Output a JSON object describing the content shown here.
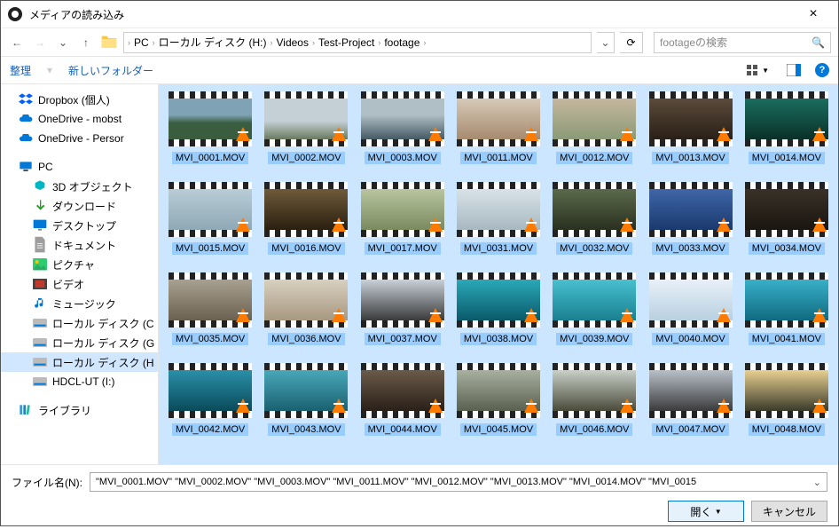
{
  "window": {
    "title": "メディアの読み込み",
    "close": "×"
  },
  "breadcrumb": {
    "items": [
      "PC",
      "ローカル ディスク (H:)",
      "Videos",
      "Test-Project",
      "footage"
    ]
  },
  "search": {
    "placeholder": "footageの検索"
  },
  "toolbar": {
    "organize": "整理",
    "newfolder": "新しいフォルダー"
  },
  "sidebar": {
    "items": [
      {
        "label": "Dropbox (個人)",
        "icon": "dropbox",
        "level": 0
      },
      {
        "label": "OneDrive - mobst",
        "icon": "cloud",
        "level": 0
      },
      {
        "label": "OneDrive - Persor",
        "icon": "cloud",
        "level": 0
      },
      {
        "spacer": true
      },
      {
        "label": "PC",
        "icon": "pc",
        "level": 0
      },
      {
        "label": "3D オブジェクト",
        "icon": "3d",
        "level": 1
      },
      {
        "label": "ダウンロード",
        "icon": "download",
        "level": 1
      },
      {
        "label": "デスクトップ",
        "icon": "desktop",
        "level": 1
      },
      {
        "label": "ドキュメント",
        "icon": "doc",
        "level": 1
      },
      {
        "label": "ピクチャ",
        "icon": "pic",
        "level": 1
      },
      {
        "label": "ビデオ",
        "icon": "video",
        "level": 1
      },
      {
        "label": "ミュージック",
        "icon": "music",
        "level": 1
      },
      {
        "label": "ローカル ディスク (C",
        "icon": "disk",
        "level": 1
      },
      {
        "label": "ローカル ディスク (G",
        "icon": "disk",
        "level": 1
      },
      {
        "label": "ローカル ディスク (H",
        "icon": "disk",
        "level": 1,
        "selected": true
      },
      {
        "label": "HDCL-UT (I:)",
        "icon": "disk",
        "level": 1
      },
      {
        "spacer": true
      },
      {
        "label": "ライブラリ",
        "icon": "lib",
        "level": 0
      }
    ]
  },
  "files": [
    {
      "name": "MVI_0001.MOV",
      "bg": "linear-gradient(#7fa3b5 40%,#3a5c3f 60%)"
    },
    {
      "name": "MVI_0002.MOV",
      "bg": "linear-gradient(#c5d0d6 55%,#6a7a5e)"
    },
    {
      "name": "MVI_0003.MOV",
      "bg": "linear-gradient(#b0bec5 40%,#455a64)"
    },
    {
      "name": "MVI_0011.MOV",
      "bg": "linear-gradient(#d7c9b8,#a68b6e)"
    },
    {
      "name": "MVI_0012.MOV",
      "bg": "linear-gradient(#c5b79e,#8a9a76)"
    },
    {
      "name": "MVI_0013.MOV",
      "bg": "linear-gradient(#5a4a3a,#2a2018)"
    },
    {
      "name": "MVI_0014.MOV",
      "bg": "linear-gradient(#1a6e5f,#0a3028)"
    },
    {
      "name": "MVI_0015.MOV",
      "bg": "linear-gradient(#b8cdd6,#8fa8b5)"
    },
    {
      "name": "MVI_0016.MOV",
      "bg": "linear-gradient(#6e5a3a,#2a1f10)"
    },
    {
      "name": "MVI_0017.MOV",
      "bg": "linear-gradient(#b8c5a0,#7a8a5e)"
    },
    {
      "name": "MVI_0031.MOV",
      "bg": "linear-gradient(#d8e2e8,#a8b8c0)"
    },
    {
      "name": "MVI_0032.MOV",
      "bg": "linear-gradient(#5a6a4a,#2a3020)"
    },
    {
      "name": "MVI_0033.MOV",
      "bg": "linear-gradient(#4066a8,#1a3a6e)"
    },
    {
      "name": "MVI_0034.MOV",
      "bg": "linear-gradient(#3a3228,#1a1510)"
    },
    {
      "name": "MVI_0035.MOV",
      "bg": "linear-gradient(#a8a090,#6a6050)"
    },
    {
      "name": "MVI_0036.MOV",
      "bg": "linear-gradient(#d8d0c0,#a89880)"
    },
    {
      "name": "MVI_0037.MOV",
      "bg": "linear-gradient(#c8d0d8,#3a3a3a)"
    },
    {
      "name": "MVI_0038.MOV",
      "bg": "linear-gradient(#2aa8b8,#0a5a6a)"
    },
    {
      "name": "MVI_0039.MOV",
      "bg": "linear-gradient(#48c0d0,#1a8090)"
    },
    {
      "name": "MVI_0040.MOV",
      "bg": "linear-gradient(#e8f0f8,#b8d0e0)"
    },
    {
      "name": "MVI_0041.MOV",
      "bg": "linear-gradient(#38b0c8,#106a80)"
    },
    {
      "name": "MVI_0042.MOV",
      "bg": "linear-gradient(#2a90a8,#0a4a5a)"
    },
    {
      "name": "MVI_0043.MOV",
      "bg": "linear-gradient(#48a8b8,#1a6070)"
    },
    {
      "name": "MVI_0044.MOV",
      "bg": "linear-gradient(#6a5a4a,#2a2018)"
    },
    {
      "name": "MVI_0045.MOV",
      "bg": "linear-gradient(#a8b0a0,#5a6050)"
    },
    {
      "name": "MVI_0046.MOV",
      "bg": "linear-gradient(#c8d0c8,#4a4a3a)"
    },
    {
      "name": "MVI_0047.MOV",
      "bg": "linear-gradient(#b8c0c8,#3a3a3a)"
    },
    {
      "name": "MVI_0048.MOV",
      "bg": "linear-gradient(#e8d090,#3a3a2a)"
    }
  ],
  "footer": {
    "label": "ファイル名(N):",
    "value": "\"MVI_0001.MOV\" \"MVI_0002.MOV\" \"MVI_0003.MOV\" \"MVI_0011.MOV\" \"MVI_0012.MOV\" \"MVI_0013.MOV\" \"MVI_0014.MOV\" \"MVI_0015",
    "open": "開く",
    "cancel": "キャンセル"
  },
  "icons": {
    "dropbox": "<svg viewBox='0 0 24 24'><path fill='#0061ff' d='M6 2l6 4-6 4-6-4zM18 2l6 4-6 4-6-4zM6 12l6 4-6 4-6-4zM18 12l6 4-6 4-6-4z'/></svg>",
    "cloud": "<svg viewBox='0 0 24 16'><path fill='#0078d7' d='M6 4a6 6 0 0112 0 4 4 0 012 8H5a4 4 0 011-8z'/></svg>",
    "pc": "<svg viewBox='0 0 24 20'><rect fill='#0078d7' x='2' y='2' width='20' height='12' rx='1'/><rect fill='#555' x='8' y='15' width='8' height='3'/></svg>",
    "3d": "<svg viewBox='0 0 24 24'><path fill='#00b7c3' d='M12 2l8 4v8l-8 4-8-4V6z'/></svg>",
    "download": "<svg viewBox='0 0 24 24'><path fill='#1ba01b' d='M12 2v12l-4-4-2 2 7 7 7-7-2-2-4 4V2z'/></svg>",
    "desktop": "<svg viewBox='0 0 24 20'><rect fill='#0078d7' x='1' y='1' width='22' height='14' rx='1'/><rect fill='#888' x='9' y='16' width='6' height='3'/></svg>",
    "doc": "<svg viewBox='0 0 20 24'><path fill='#9e9e9e' d='M3 1h10l4 4v18H3z'/><path fill='#fff' d='M6 10h8v1H6zm0 3h8v1H6zm0 3h8v1H6z'/></svg>",
    "pic": "<svg viewBox='0 0 24 20'><rect fill='#2ecc71' width='24' height='20' rx='2'/><circle fill='#f1c40f' cx='7' cy='6' r='3'/><path fill='#27ae60' d='M0 20l8-10 6 6 4-4 6 8z'/></svg>",
    "video": "<svg viewBox='0 0 24 18'><rect fill='#444' width='24' height='18'/><rect fill='#c0392b' x='4' y='3' width='16' height='12'/></svg>",
    "music": "<svg viewBox='0 0 24 24'><path fill='#0078d7' d='M9 3v12a3 3 0 11-2-2V7l10-2v8a3 3 0 11-2-2V3z'/></svg>",
    "disk": "<svg viewBox='0 0 24 16'><rect fill='#bbb' width='24' height='16' rx='2'/><rect fill='#0078d7' x='2' y='10' width='20' height='3'/></svg>",
    "lib": "<svg viewBox='0 0 24 20'><rect fill='#3498db' x='2' y='2' width='4' height='16'/><rect fill='#2980b9' x='8' y='2' width='4' height='16'/><rect fill='#1abc9c' x='14' y='2' width='4' height='16' transform='rotate(8 16 10)'/></svg>",
    "folder": "<svg viewBox='0 0 24 20'><path fill='#ffca28' d='M2 2h7l2 3h11v13H2z'/><path fill='#ffe082' d='M2 6h20v12H2z'/></svg>"
  }
}
